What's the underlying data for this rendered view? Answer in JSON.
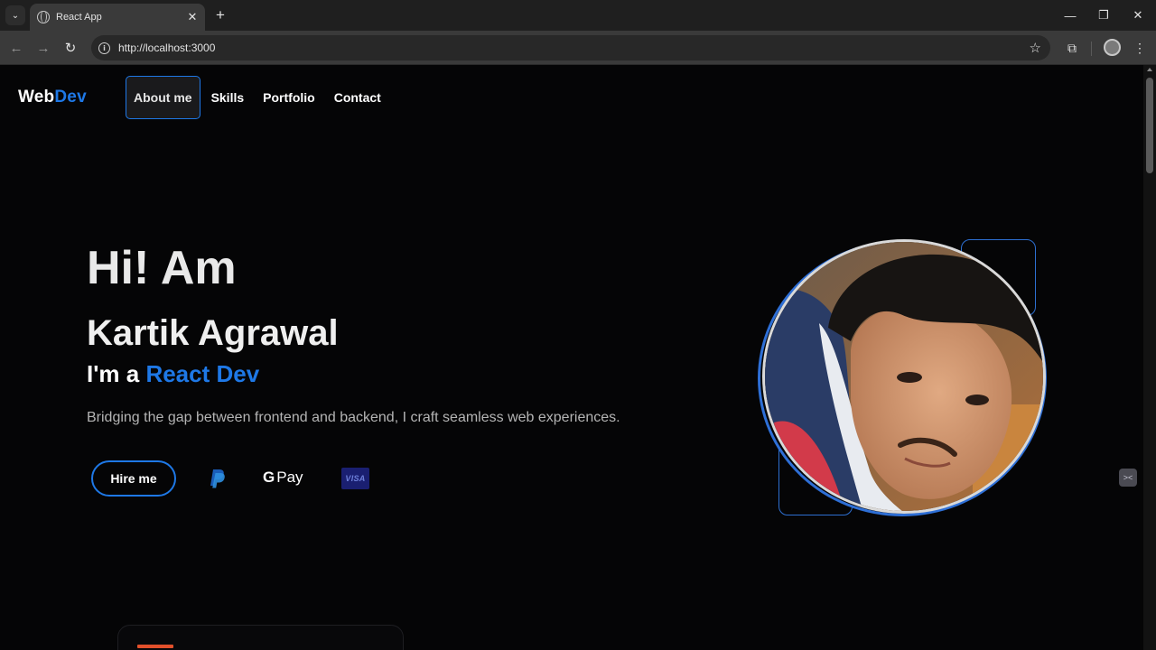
{
  "browser": {
    "tab_title": "React App",
    "url": "http://localhost:3000",
    "icons": {
      "tab_search": "chevron-down-icon",
      "favicon": "globe-icon",
      "close_tab": "close-icon",
      "new_tab": "plus-icon",
      "back": "arrow-left-icon",
      "forward": "arrow-right-icon",
      "reload": "reload-icon",
      "site_info": "info-icon",
      "bookmark": "star-icon",
      "extensions": "puzzle-icon",
      "profile": "avatar-icon",
      "menu": "kebab-menu-icon"
    },
    "labels": {
      "tab_search": "⌄",
      "close_tab": "✕",
      "new_tab": "+",
      "back": "←",
      "forward": "→",
      "reload": "↻",
      "site_info": "i",
      "bookmark": "☆",
      "extensions": "⧉",
      "menu": "⋮",
      "minimize": "—",
      "restore": "❐",
      "close_window": "✕"
    }
  },
  "site": {
    "logo": {
      "part1": "Web",
      "part2": "Dev"
    },
    "nav": [
      {
        "label": "About me",
        "selected": true
      },
      {
        "label": "Skills"
      },
      {
        "label": "Portfolio"
      },
      {
        "label": "Contact"
      }
    ],
    "hero": {
      "greeting": "Hi! Am",
      "name": "Kartik Agrawal",
      "role_prefix": "I'm a ",
      "role": "React Dev",
      "tagline": "Bridging the gap between frontend and backend, I craft seamless web experiences.",
      "hire_label": "Hire me",
      "payment_icons": [
        "paypal-icon",
        "google-pay-icon",
        "visa-icon"
      ],
      "gpay_g": "G",
      "gpay_text": "Pay",
      "visa_text": "VISA"
    },
    "side_widget": "><",
    "colors": {
      "accent": "#1e78e6",
      "background": "#050506",
      "card_accent": "#e2502b"
    }
  }
}
